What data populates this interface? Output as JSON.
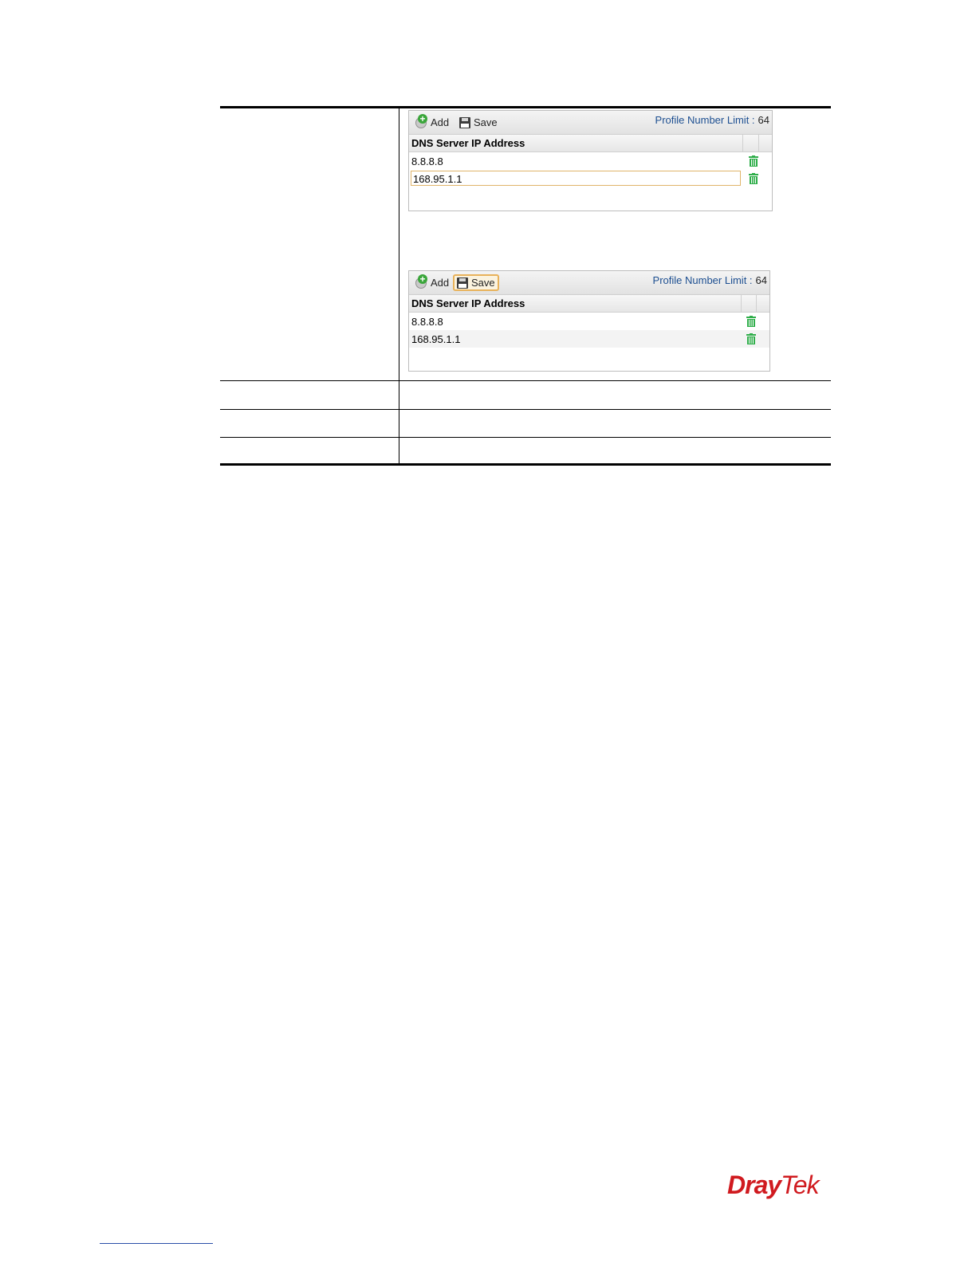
{
  "panels": [
    {
      "toolbar": {
        "add_label": "Add",
        "save_label": "Save",
        "limit_label": "Profile Number Limit :",
        "limit_value": "64"
      },
      "column_header": "DNS Server IP Address",
      "rows": [
        "8.8.8.8",
        "168.95.1.1"
      ]
    },
    {
      "toolbar": {
        "add_label": "Add",
        "save_label": "Save",
        "limit_label": "Profile Number Limit :",
        "limit_value": "64"
      },
      "column_header": "DNS Server IP Address",
      "rows": [
        "8.8.8.8",
        "168.95.1.1"
      ]
    }
  ],
  "logo": {
    "dray": "Dray",
    "tek": "Tek"
  },
  "colors": {
    "logo": "#d01a1f",
    "limit_text": "#1d4f91",
    "trash": "#2fae4a",
    "save_highlight": "#e8b25a"
  }
}
